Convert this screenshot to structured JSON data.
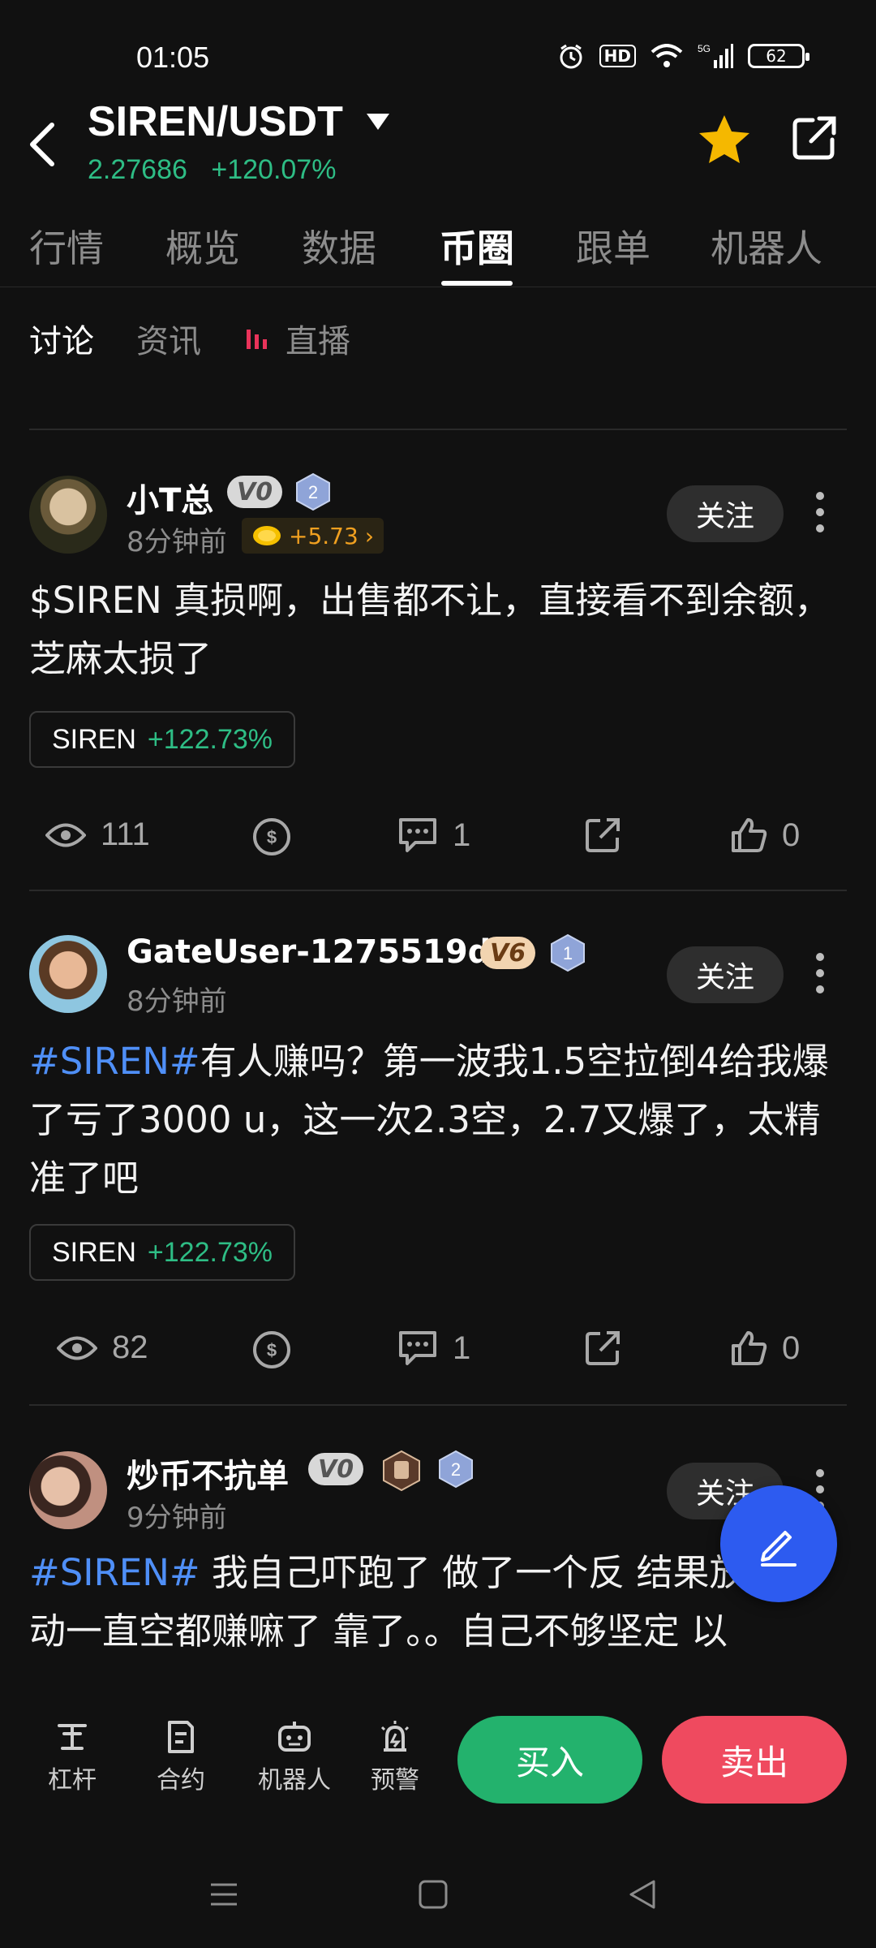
{
  "status_bar": {
    "time": "01:05",
    "hd": "HD",
    "network": "5G",
    "battery": "62"
  },
  "header": {
    "pair": "SIREN/USDT",
    "price": "2.27686",
    "change": "+120.07%"
  },
  "tabs": [
    "行情",
    "概览",
    "数据",
    "币圈",
    "跟单",
    "机器人"
  ],
  "active_tab": "币圈",
  "subtabs": {
    "discussion": "讨论",
    "news": "资讯",
    "live": "直播"
  },
  "posts": [
    {
      "user": "小T总",
      "level": "V0",
      "rank": "2",
      "time": "8分钟前",
      "coin_reward": "+5.73",
      "text": "$SIREN 真损啊，出售都不让，直接看不到余额，芝麻太损了",
      "chip_symbol": "SIREN",
      "chip_change": "+122.73%",
      "views": "111",
      "comments": "1",
      "likes": "0",
      "follow": "关注"
    },
    {
      "user": "GateUser-1275519d",
      "level": "V6",
      "rank": "1",
      "time": "8分钟前",
      "hashtag": "#SIREN#",
      "text": "有人赚吗？第一波我1.5空拉倒4给我爆了亏了3000 u，这一次2.3空，2.7又爆了，太精准了吧",
      "chip_symbol": "SIREN",
      "chip_change": "+122.73%",
      "views": "82",
      "comments": "1",
      "likes": "0",
      "follow": "关注"
    },
    {
      "user": "炒币不抗单",
      "level": "V0",
      "rank": "2",
      "time": "9分钟前",
      "hashtag": "#SIREN#",
      "text": " 我自己吓跑了 做了一个反 结果放着不动一直空都赚嘛了  靠了。。自己不够坚定 以",
      "follow": "关注"
    }
  ],
  "bottom_bar": {
    "leverage": "杠杆",
    "contract": "合约",
    "robot": "机器人",
    "alert": "预警",
    "buy": "买入",
    "sell": "卖出"
  },
  "colors": {
    "green": "#2ebd85",
    "red": "#ef4a5f",
    "blue": "#2d5bf0",
    "gold": "#f5b800"
  }
}
